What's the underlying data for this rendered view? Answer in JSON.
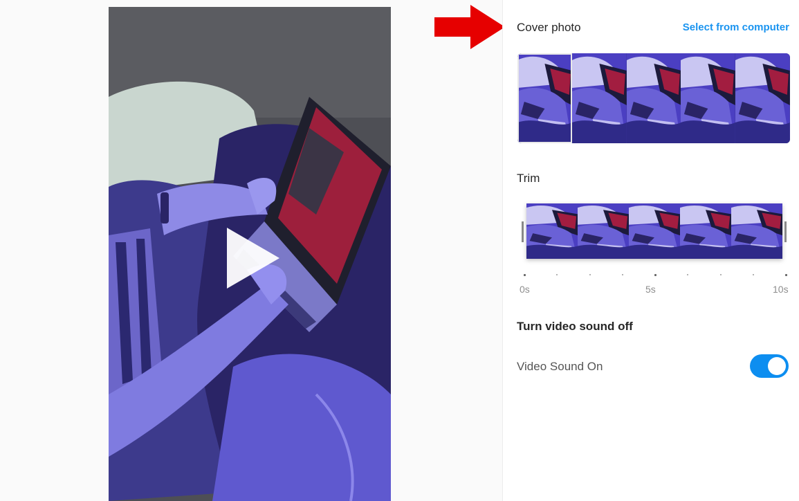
{
  "cover": {
    "heading": "Cover photo",
    "select_link": "Select from computer",
    "frame_count": 5,
    "selected_frame": 1
  },
  "trim": {
    "heading": "Trim",
    "frame_count": 5,
    "time_labels": [
      "0s",
      "5s",
      "10s"
    ]
  },
  "sound": {
    "heading": "Turn video sound off",
    "toggle_label": "Video Sound On",
    "toggle_on": true
  },
  "colors": {
    "accent": "#0d8ef0",
    "link": "#1a94f0",
    "annotation_arrow": "#e60000",
    "thumbnail_tint": "#4b3fc2"
  },
  "icons": {
    "play": "play-icon",
    "arrow": "red-arrow-icon"
  }
}
